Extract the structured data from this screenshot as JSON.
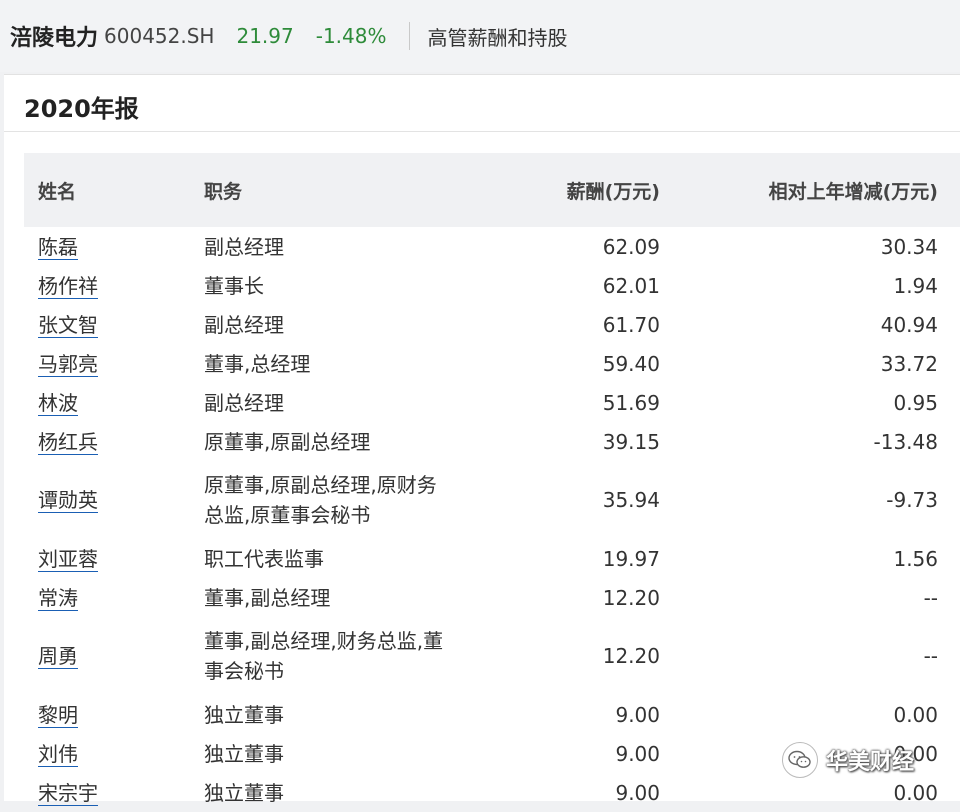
{
  "header": {
    "stock_name": "涪陵电力",
    "stock_code": "600452.SH",
    "price": "21.97",
    "change": "-1.48%",
    "section": "高管薪酬和持股"
  },
  "report": {
    "title": "2020年报"
  },
  "table": {
    "columns": [
      "姓名",
      "职务",
      "薪酬(万元)",
      "相对上年增减(万元)"
    ],
    "rows": [
      {
        "name": "陈磊",
        "position": "副总经理",
        "pay": "62.09",
        "change": "30.34"
      },
      {
        "name": "杨作祥",
        "position": "董事长",
        "pay": "62.01",
        "change": "1.94"
      },
      {
        "name": "张文智",
        "position": "副总经理",
        "pay": "61.70",
        "change": "40.94"
      },
      {
        "name": "马郭亮",
        "position": "董事,总经理",
        "pay": "59.40",
        "change": "33.72"
      },
      {
        "name": "林波",
        "position": "副总经理",
        "pay": "51.69",
        "change": "0.95"
      },
      {
        "name": "杨红兵",
        "position": "原董事,原副总经理",
        "pay": "39.15",
        "change": "-13.48"
      },
      {
        "name": "谭勋英",
        "position": "原董事,原副总经理,原财务总监,原董事会秘书",
        "pay": "35.94",
        "change": "-9.73"
      },
      {
        "name": "刘亚蓉",
        "position": "职工代表监事",
        "pay": "19.97",
        "change": "1.56"
      },
      {
        "name": "常涛",
        "position": "董事,副总经理",
        "pay": "12.20",
        "change": "--"
      },
      {
        "name": "周勇",
        "position": "董事,副总经理,财务总监,董事会秘书",
        "pay": "12.20",
        "change": "--"
      },
      {
        "name": "黎明",
        "position": "独立董事",
        "pay": "9.00",
        "change": "0.00"
      },
      {
        "name": "刘伟",
        "position": "独立董事",
        "pay": "9.00",
        "change": "0.00"
      },
      {
        "name": "宋宗宇",
        "position": "独立董事",
        "pay": "9.00",
        "change": "0.00"
      }
    ]
  },
  "watermark": {
    "text": "华美财经",
    "icon": "wechat-icon"
  }
}
